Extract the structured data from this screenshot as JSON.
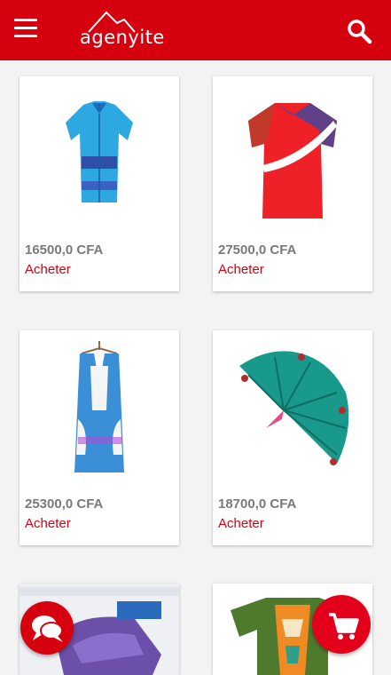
{
  "header": {
    "logo_text": "agenyite",
    "menu_icon": "hamburger-menu-icon",
    "search_icon": "search-icon",
    "bar_color": "#d6010f"
  },
  "products": [
    {
      "price": "16500,0 CFA",
      "buy_label": "Acheter",
      "image": "blue-patterned-shirt"
    },
    {
      "price": "27500,0 CFA",
      "buy_label": "Acheter",
      "image": "red-plaid-shirt"
    },
    {
      "price": "25300,0 CFA",
      "buy_label": "Acheter",
      "image": "blue-sleeveless-dress"
    },
    {
      "price": "18700,0 CFA",
      "buy_label": "Acheter",
      "image": "green-fan-fabric"
    },
    {
      "image": "purple-steam-iron"
    },
    {
      "image": "green-patterned-tshirt"
    }
  ],
  "floating": {
    "chat_icon": "chat-bubbles-icon",
    "cart_icon": "shopping-cart-icon",
    "accent_color": "#e3001b"
  }
}
